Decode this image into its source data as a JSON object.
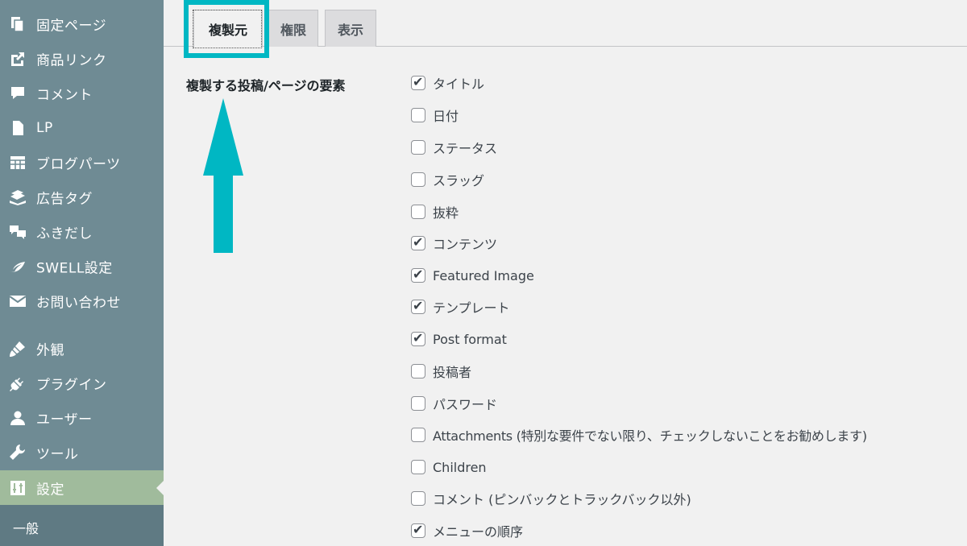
{
  "sidebar": {
    "items": [
      {
        "label": "固定ページ",
        "icon": "pages-icon"
      },
      {
        "label": "商品リンク",
        "icon": "share-link-icon"
      },
      {
        "label": "コメント",
        "icon": "comment-icon"
      },
      {
        "label": "LP",
        "icon": "document-icon"
      },
      {
        "label": "ブログパーツ",
        "icon": "grid-icon"
      },
      {
        "label": "広告タグ",
        "icon": "books-icon"
      },
      {
        "label": "ふきだし",
        "icon": "speech-bubbles-icon"
      },
      {
        "label": "SWELL設定",
        "icon": "swell-leaf-icon"
      },
      {
        "label": "お問い合わせ",
        "icon": "mail-icon"
      },
      {
        "label": "外観",
        "icon": "paintbrush-icon"
      },
      {
        "label": "プラグイン",
        "icon": "plug-icon"
      },
      {
        "label": "ユーザー",
        "icon": "user-icon"
      },
      {
        "label": "ツール",
        "icon": "wrench-icon"
      },
      {
        "label": "設定",
        "icon": "settings-sliders-icon"
      }
    ],
    "submenu": {
      "label": "一般"
    }
  },
  "tabs": [
    {
      "label": "複製元",
      "active": true
    },
    {
      "label": "権限",
      "active": false
    },
    {
      "label": "表示",
      "active": false
    }
  ],
  "form": {
    "field_label": "複製する投稿/ページの要素",
    "options": [
      {
        "label": "タイトル",
        "checked": true
      },
      {
        "label": "日付",
        "checked": false
      },
      {
        "label": "ステータス",
        "checked": false
      },
      {
        "label": "スラッグ",
        "checked": false
      },
      {
        "label": "抜粋",
        "checked": false
      },
      {
        "label": "コンテンツ",
        "checked": true
      },
      {
        "label": "Featured Image",
        "checked": true
      },
      {
        "label": "テンプレート",
        "checked": true
      },
      {
        "label": "Post format",
        "checked": true
      },
      {
        "label": "投稿者",
        "checked": false
      },
      {
        "label": "パスワード",
        "checked": false
      },
      {
        "label": "Attachments (特別な要件でない限り、チェックしないことをお勧めします)",
        "checked": false
      },
      {
        "label": "Children",
        "checked": false
      },
      {
        "label": "コメント (ピンバックとトラックバック以外)",
        "checked": false
      },
      {
        "label": "メニューの順序",
        "checked": true
      }
    ]
  },
  "colors": {
    "sidebar_bg": "#6f8b94",
    "sidebar_active_bg": "#a0bb9c",
    "highlight": "#00b7c3",
    "page_bg": "#f1f1f1"
  }
}
